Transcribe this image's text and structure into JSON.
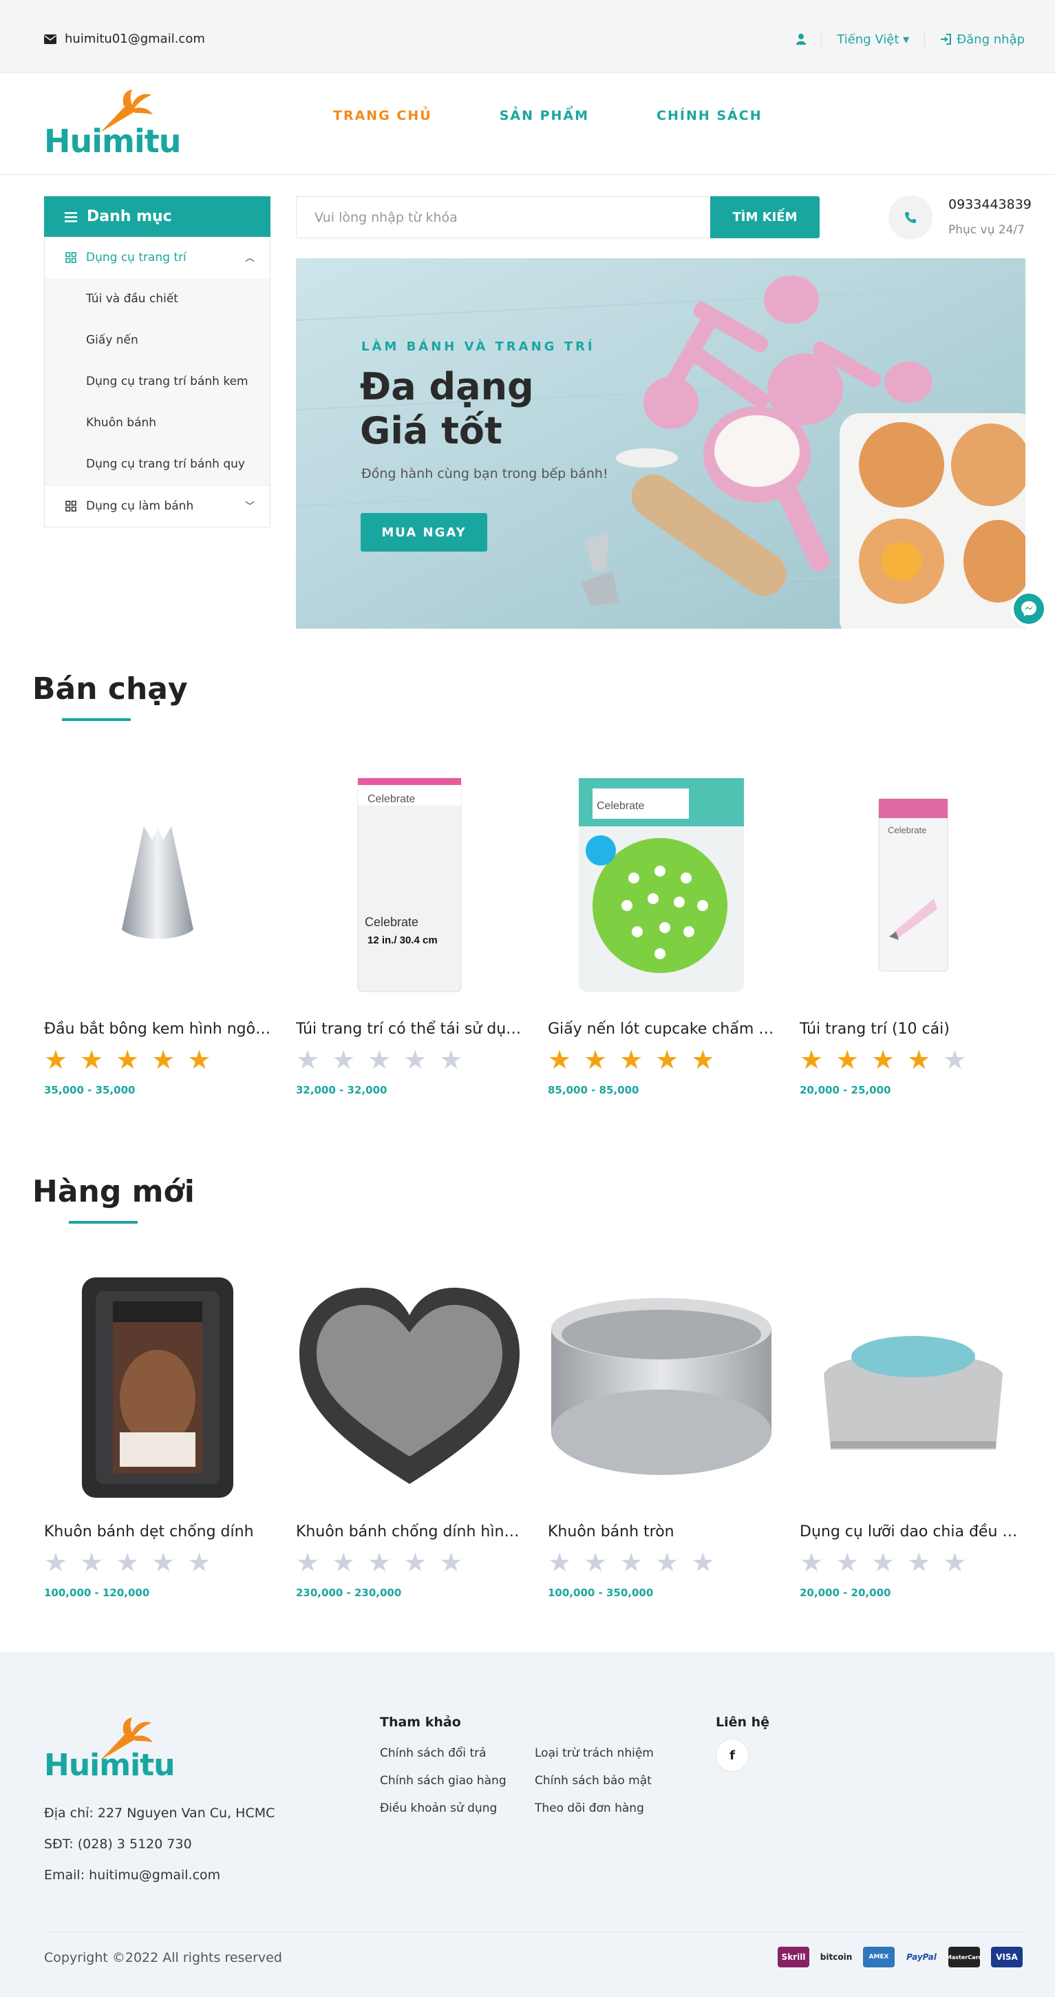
{
  "topbar": {
    "email": "huimitu01@gmail.com",
    "language": "Tiếng Việt",
    "login": "Đăng nhập"
  },
  "brand": {
    "name": "Huimitu",
    "accent": "#1aa6a0",
    "orange": "#f28a1a"
  },
  "nav": [
    {
      "label": "TRANG CHỦ",
      "active": true
    },
    {
      "label": "SẢN PHẨM",
      "active": false
    },
    {
      "label": "CHÍNH SÁCH",
      "active": false
    }
  ],
  "sidebar": {
    "title": "Danh mục",
    "group1": "Dụng cụ trang trí",
    "sub": [
      "Túi và đầu chiết",
      "Giấy nến",
      "Dụng cụ trang trí bánh kem",
      "Khuôn bánh",
      "Dụng cụ trang trí bánh quy"
    ],
    "group2": "Dụng cụ làm bánh"
  },
  "search": {
    "placeholder": "Vui lòng nhập từ khóa",
    "button": "TÌM KIẾM"
  },
  "contact": {
    "phone": "0933443839",
    "service": "Phục vụ 24/7"
  },
  "banner": {
    "kicker": "LÀM BÁNH VÀ TRANG TRÍ",
    "title1": "Đa dạng",
    "title2": "Giá tốt",
    "subtitle": "Đồng hành cùng bạn trong bếp bánh!",
    "button": "MUA NGAY"
  },
  "bestsellers": {
    "title": "Bán chạy",
    "items": [
      {
        "name": "Đầu bắt bông kem hình ngôi sao",
        "rating": 5,
        "price": "35,000 - 35,000"
      },
      {
        "name": "Túi trang trí có thể tái sử dụng",
        "rating": 0,
        "price": "32,000 - 32,000"
      },
      {
        "name": "Giấy nến lót cupcake chấm bi xanh",
        "rating": 5,
        "price": "85,000 - 85,000"
      },
      {
        "name": "Túi trang trí (10 cái)",
        "rating": 4,
        "price": "20,000 - 25,000"
      }
    ]
  },
  "newitems": {
    "title": "Hàng mới",
    "items": [
      {
        "name": "Khuôn bánh dẹt chống dính",
        "rating": 0,
        "price": "100,000 - 120,000"
      },
      {
        "name": "Khuôn bánh chống dính hình trái tim",
        "rating": 0,
        "price": "230,000 - 230,000"
      },
      {
        "name": "Khuôn bánh tròn",
        "rating": 0,
        "price": "100,000 - 350,000"
      },
      {
        "name": "Dụng cụ lưỡi dao chia đều bột",
        "rating": 0,
        "price": "20,000 - 20,000"
      }
    ]
  },
  "footer": {
    "address": "Địa chỉ: 227 Nguyen Van Cu, HCMC",
    "phone": "SĐT: (028) 3 5120 730",
    "email": "Email: huitimu@gmail.com",
    "ref_title": "Tham khảo",
    "ref_col1": [
      "Chính sách đổi trả",
      "Chính sách giao hàng",
      "Điều khoản sử dụng"
    ],
    "ref_col2": [
      "Loại trừ trách nhiệm",
      "Chính sách bảo mật",
      "Theo dõi đơn hàng"
    ],
    "contact_title": "Liên hệ",
    "copyright": "Copyright ©2022 All rights reserved",
    "payments": [
      "Skrill",
      "bitcoin",
      "AMEX",
      "PayPal",
      "MasterCard",
      "VISA"
    ]
  }
}
